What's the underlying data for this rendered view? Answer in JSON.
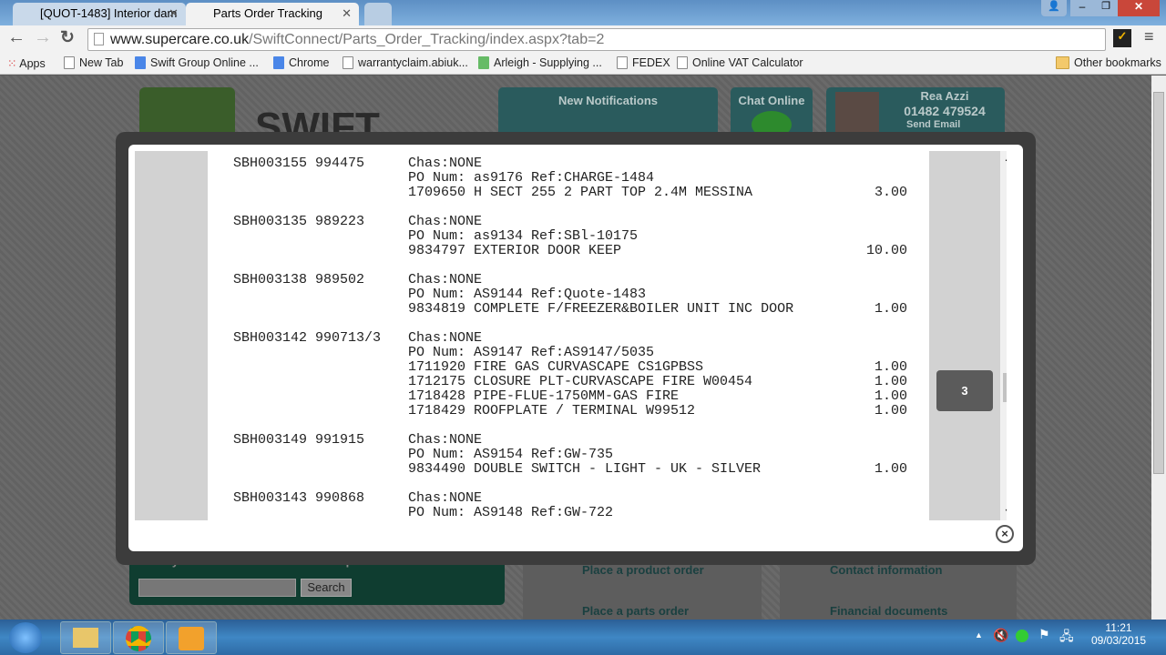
{
  "browser": {
    "tabs": [
      {
        "title": "[QUOT-1483] Interior dam",
        "active": false
      },
      {
        "title": "Parts Order Tracking",
        "active": true
      }
    ],
    "url_host": "www.supercare.co.uk",
    "url_path": "/SwiftConnect/Parts_Order_Tracking/index.aspx?tab=2",
    "bookmarks": [
      "Apps",
      "New Tab",
      "Swift Group Online ...",
      "Chrome",
      "warrantyclaim.abiuk...",
      "Arleigh - Supplying ...",
      "FEDEX",
      "Online VAT Calculator"
    ],
    "other_bookmarks": "Other bookmarks"
  },
  "site": {
    "logo": "SWIFT",
    "notifications_title": "New Notifications",
    "chat_title": "Chat Online",
    "user": {
      "name": "Rea Azzi",
      "phone": "01482 479524",
      "email_label": "Send Email"
    },
    "chassis_prompt": "Enter your chassis number to see important notifications:",
    "search_label": "Search",
    "links": [
      "Place a product order",
      "Place a parts order",
      "Contact information",
      "Financial documents"
    ]
  },
  "modal": {
    "orders": [
      {
        "id": "SBH003155 994475",
        "chas": "Chas:NONE",
        "po": "PO Num: as9176 Ref:CHARGE-1484",
        "items": [
          {
            "desc": "1709650 H SECT 255 2 PART TOP 2.4M MESSINA",
            "qty": "3.00"
          }
        ]
      },
      {
        "id": "SBH003135 989223",
        "chas": "Chas:NONE",
        "po": "PO Num: as9134 Ref:SBl-10175",
        "items": [
          {
            "desc": "9834797 EXTERIOR DOOR KEEP",
            "qty": "10.00"
          }
        ]
      },
      {
        "id": "SBH003138 989502",
        "chas": "Chas:NONE",
        "po": "PO Num: AS9144 Ref:Quote-1483",
        "items": [
          {
            "desc": "9834819 COMPLETE F/FREEZER&BOILER UNIT INC DOOR",
            "qty": "1.00"
          }
        ]
      },
      {
        "id": "SBH003142 990713/3",
        "chas": "Chas:NONE",
        "po": "PO Num: AS9147 Ref:AS9147/5035",
        "items": [
          {
            "desc": "1711920 FIRE GAS CURVASCAPE CS1GPBSS",
            "qty": "1.00"
          },
          {
            "desc": "1712175 CLOSURE PLT-CURVASCAPE FIRE W00454",
            "qty": "1.00"
          },
          {
            "desc": "1718428 PIPE-FLUE-1750MM-GAS FIRE",
            "qty": "1.00"
          },
          {
            "desc": "1718429 ROOFPLATE / TERMINAL W99512",
            "qty": "1.00"
          }
        ]
      },
      {
        "id": "SBH003149 991915",
        "chas": "Chas:NONE",
        "po": "PO Num: AS9154 Ref:GW-735",
        "items": [
          {
            "desc": "9834490 DOUBLE SWITCH - LIGHT - UK - SILVER",
            "qty": "1.00"
          }
        ]
      },
      {
        "id": "SBH003143 990868",
        "chas": "Chas:NONE",
        "po": "PO Num: AS9148 Ref:GW-722",
        "items": []
      }
    ],
    "page_badge": "3",
    "close_label": "×"
  },
  "taskbar": {
    "time": "11:21",
    "date": "09/03/2015"
  }
}
